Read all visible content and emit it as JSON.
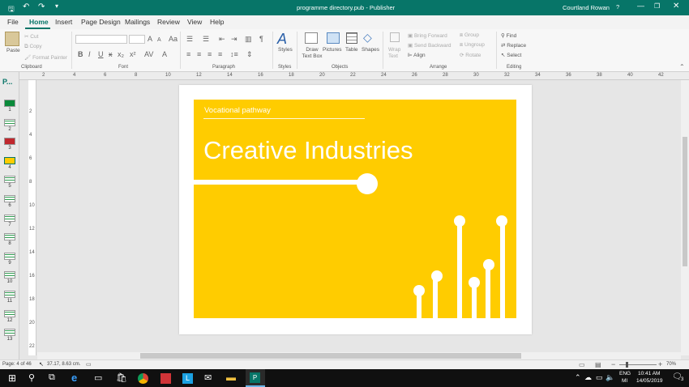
{
  "window": {
    "title": "programme directory.pub - Publisher",
    "user": "Courtland Rowan",
    "help": "?"
  },
  "tabs": [
    "File",
    "Home",
    "Insert",
    "Page Design",
    "Mailings",
    "Review",
    "View",
    "Help"
  ],
  "ribbon": {
    "clipboard": {
      "paste": "Paste",
      "cut": "Cut",
      "copy": "Copy",
      "format_painter": "Format Painter",
      "group": "Clipboard"
    },
    "font": {
      "group": "Font",
      "bold": "B",
      "italic": "I",
      "underline": "U",
      "strike": "x",
      "sub": "x₂",
      "sup": "x²",
      "clear": "A"
    },
    "paragraph": {
      "group": "Paragraph",
      "pilcrow": "¶"
    },
    "styles": {
      "label": "Styles",
      "group": "Styles"
    },
    "objects": {
      "group": "Objects",
      "draw_text_box": "Draw Text Box",
      "pictures": "Pictures",
      "table": "Table",
      "shapes": "Shapes"
    },
    "arrange": {
      "group": "Arrange",
      "wrap_text": "Wrap Text",
      "bring_forward": "Bring Forward",
      "send_backward": "Send Backward",
      "align": "Align",
      "group_btn": "Group",
      "ungroup": "Ungroup",
      "rotate": "Rotate"
    },
    "editing": {
      "group": "Editing",
      "find": "Find",
      "replace": "Replace",
      "select": "Select"
    }
  },
  "ruler_h": [
    "2",
    "4",
    "6",
    "8",
    "10",
    "12",
    "14",
    "16",
    "18",
    "20",
    "22",
    "24",
    "26",
    "28",
    "30",
    "32",
    "34",
    "36",
    "38",
    "40",
    "42"
  ],
  "ruler_v": [
    "2",
    "4",
    "6",
    "8",
    "10",
    "12",
    "14",
    "16",
    "18",
    "20",
    "22"
  ],
  "pages_panel": {
    "label": "P...",
    "pages": [
      "1",
      "2",
      "3",
      "4",
      "5",
      "6",
      "7",
      "8",
      "9",
      "10",
      "11",
      "12",
      "13"
    ],
    "selected": "4"
  },
  "page": {
    "subtitle": "Vocational pathway",
    "title": "Creative Industries",
    "bg_color": "#FFCC00",
    "fg_color": "#FFFFFF"
  },
  "status": {
    "page": "Page: 4 of 46",
    "position": "37.17, 8.63 cm.",
    "zoom": "70%"
  },
  "taskbar": {
    "lang1": "ENG",
    "lang2": "MI",
    "time": "10:41 AM",
    "date": "14/05/2019",
    "notif": "3"
  },
  "colors": {
    "accent": "#077568"
  }
}
